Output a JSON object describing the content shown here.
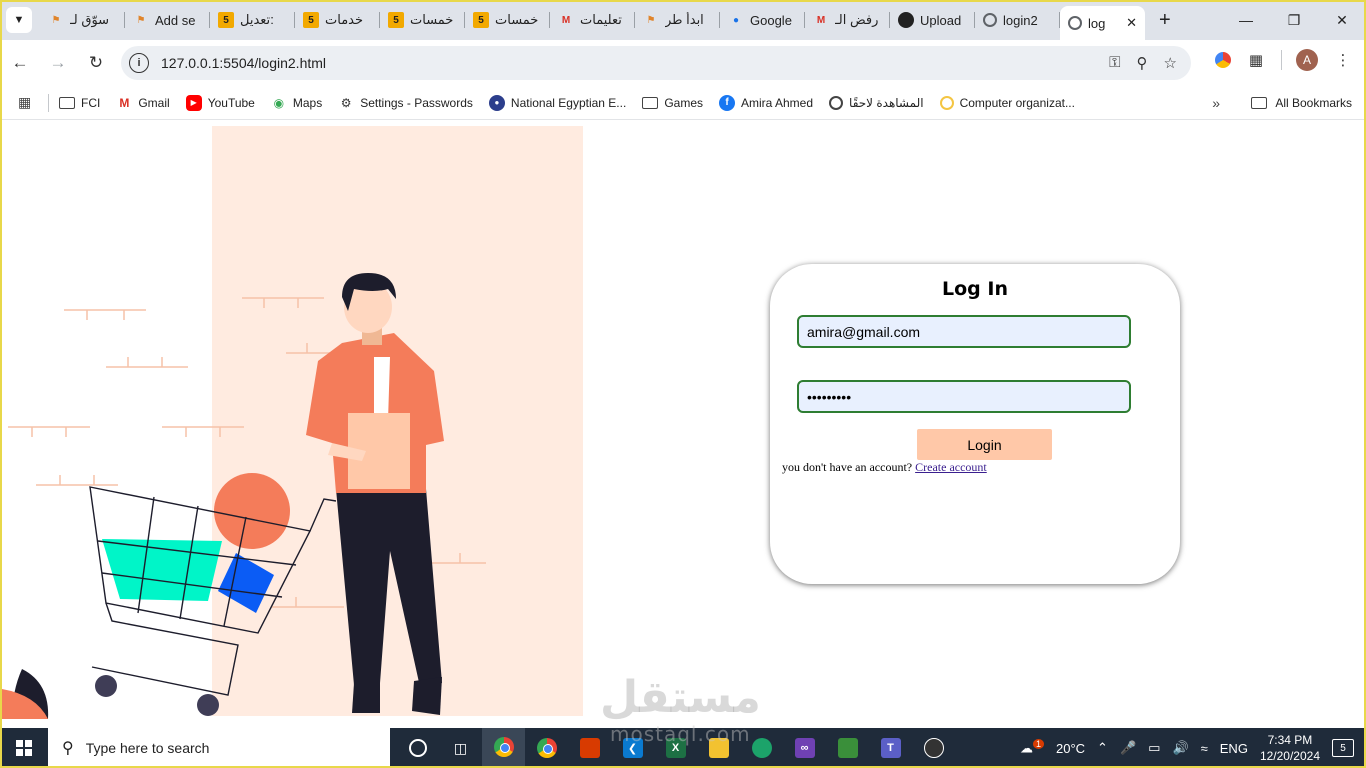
{
  "browser": {
    "tabs": [
      {
        "label": "سوّق لـ",
        "icon": "figure-icon"
      },
      {
        "label": "Add se",
        "icon": "figure-icon"
      },
      {
        "label": "تعديل:",
        "icon": "khamsat-icon"
      },
      {
        "label": "خدمات",
        "icon": "khamsat-icon"
      },
      {
        "label": "خمسات",
        "icon": "khamsat-icon"
      },
      {
        "label": "خمسات",
        "icon": "khamsat-icon"
      },
      {
        "label": "تعليمات",
        "icon": "gmail-icon"
      },
      {
        "label": "ابدأ طر",
        "icon": "figure-icon"
      },
      {
        "label": "Google",
        "icon": "key-icon"
      },
      {
        "label": "رفض الـ",
        "icon": "gmail-icon"
      },
      {
        "label": "Upload",
        "icon": "github-icon"
      },
      {
        "label": "login2",
        "icon": "globe-icon"
      },
      {
        "label": "log",
        "icon": "globe-icon"
      }
    ],
    "tab_badge": "5",
    "url": "127.0.0.1:5504/login2.html",
    "profile_initial": "A",
    "bookmarks": [
      {
        "label": "FCI",
        "icon": "folder-icon"
      },
      {
        "label": "Gmail",
        "icon": "gmail-icon"
      },
      {
        "label": "YouTube",
        "icon": "youtube-icon"
      },
      {
        "label": "Maps",
        "icon": "maps-icon"
      },
      {
        "label": "Settings - Passwords",
        "icon": "gear-icon"
      },
      {
        "label": "National Egyptian E...",
        "icon": "national-icon"
      },
      {
        "label": "Games",
        "icon": "folder-icon"
      },
      {
        "label": "Amira Ahmed",
        "icon": "facebook-icon"
      },
      {
        "label": "المشاهدة لاحقًا",
        "icon": "globe-icon"
      },
      {
        "label": "Computer organizat...",
        "icon": "circle-icon"
      }
    ],
    "all_bookmarks": "All Bookmarks"
  },
  "login": {
    "title": "Log In",
    "email_value": "amira@gmail.com",
    "password_value": "123456789",
    "button_label": "Login",
    "signup_text": "you don't have an account?",
    "signup_link": "Create account"
  },
  "watermark": {
    "text": "مستقل",
    "sub": "mostaql.com"
  },
  "taskbar": {
    "search_placeholder": "Type here to search",
    "weather": "20°C",
    "language": "ENG",
    "time": "7:34 PM",
    "date": "12/20/2024",
    "notifications": "5",
    "weather_badge": "1"
  },
  "colors": {
    "accent_peach": "#ffc8a8",
    "illustration_bg": "#ffebe0",
    "field_border": "#2e7d32",
    "field_bg": "#e8f0fe",
    "shirt": "#f47c5a",
    "trouser": "#1d1d2c",
    "cart_cyan": "#00f5c8",
    "cart_blue": "#0b5cf5"
  }
}
